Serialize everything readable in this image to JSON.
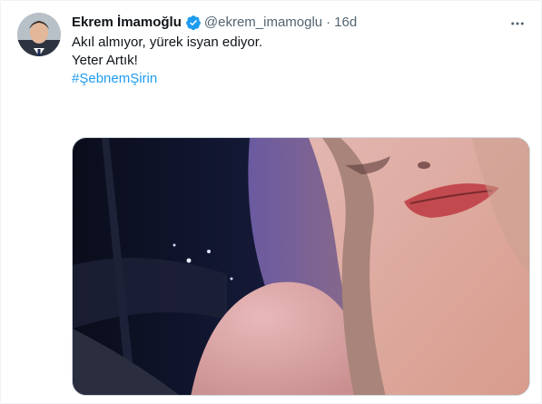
{
  "tweet": {
    "author_name": "Ekrem İmamoğlu",
    "handle": "@ekrem_imamoglu",
    "separator": "·",
    "time": "16d",
    "lines": [
      "Akıl almıyor, yürek isyan ediyor.",
      "Yeter Artık!"
    ],
    "hashtag": "#ŞebnemŞirin"
  },
  "icons": {
    "verified": "verified-badge-icon",
    "more": "more-options-icon"
  },
  "colors": {
    "link": "#1d9bf0",
    "verified": "#1d9bf0",
    "secondary_text": "#536471"
  }
}
